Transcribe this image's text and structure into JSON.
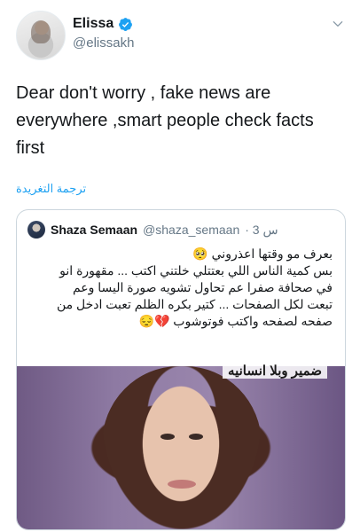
{
  "tweet": {
    "display_name": "Elissa",
    "handle": "@elissakh",
    "text": "Dear don't worry , fake news are everywhere ,smart people check facts first",
    "translate_label": "ترجمة التغريدة"
  },
  "quoted_tweet": {
    "display_name": "Shaza Semaan",
    "handle": "@shaza_semaan",
    "time": "· 3 س",
    "lines": [
      "بعرف مو وقتها اعذروني 🥺",
      "بس كمية الناس اللي بعتتلي خلتني اكتب ... مقهورة انو",
      "في صحافة صفرا عم تحاول تشويه صورة اليسا وعم",
      "تبعت لكل الصفحات ... كتير بكره الظلم تعبت ادخل من",
      "صفحه لصفحه واكتب فوتوشوب 💔😔"
    ],
    "image_caption": "ضمير وبلا انسانيه"
  },
  "colors": {
    "accent": "#1da1f2",
    "text": "#14171a",
    "muted": "#657786",
    "border": "#ccd6dd"
  },
  "icons": {
    "verified": "verified-badge-icon",
    "menu": "chevron-down-icon"
  }
}
